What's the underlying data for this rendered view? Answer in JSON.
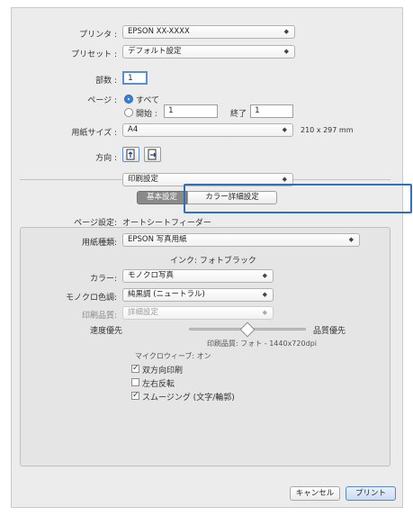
{
  "printer": {
    "label": "プリンタ :",
    "value": "EPSON XX-XXXX"
  },
  "preset": {
    "label": "プリセット :",
    "value": "デフォルト設定"
  },
  "copies": {
    "label": "部数 :",
    "value": "1"
  },
  "pages": {
    "label": "ページ :",
    "all_label": "すべて",
    "from_label": "開始 :",
    "from_value": "1",
    "to_label": "終了 :",
    "to_value": "1"
  },
  "paper_size": {
    "label": "用紙サイズ :",
    "value": "A4",
    "dimensions": "210 x 297 mm"
  },
  "orientation": {
    "label": "方向 :"
  },
  "section_select": {
    "value": "印刷設定"
  },
  "tabs": {
    "basic": "基本設定",
    "color": "カラー詳細設定"
  },
  "page_setup": {
    "label": "ページ設定:",
    "value": "オートシートフィーダー"
  },
  "media_type": {
    "label": "用紙種類:",
    "value": "EPSON 写真用紙"
  },
  "ink": {
    "text": "インク: フォトブラック"
  },
  "color": {
    "label": "カラー:",
    "value": "モノクロ写真"
  },
  "mono_tone": {
    "label": "モノクロ色調:",
    "value": "純黒調 (ニュートラル)"
  },
  "print_quality": {
    "label": "印刷品質:",
    "value": "詳細設定"
  },
  "speed_quality": {
    "left": "速度優先",
    "right": "品質優先",
    "level": 0.5
  },
  "quality_info": {
    "line1": "印刷品質: フォト - 1440x720dpi",
    "line2": "マイクロウィーブ: オン"
  },
  "options": {
    "bidirectional": {
      "label": "双方向印刷",
      "checked": true
    },
    "mirror": {
      "label": "左右反転",
      "checked": false
    },
    "smoothing": {
      "label": "スムージング (文字/輪郭)",
      "checked": true
    }
  },
  "buttons": {
    "cancel": "キャンセル",
    "print": "プリント"
  },
  "colors": {
    "highlight": "#2f6fc0",
    "primary_btn": "#c9dcf4"
  }
}
